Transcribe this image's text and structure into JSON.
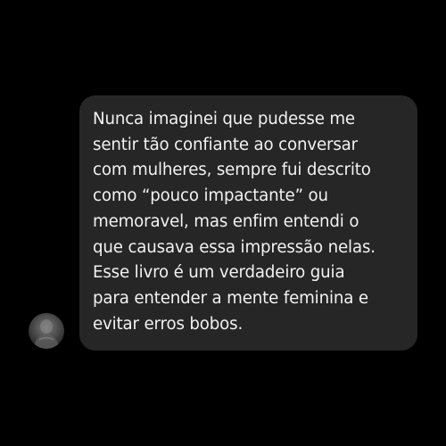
{
  "chat": {
    "sender_avatar_icon": "user-photo-avatar",
    "bubble_color": "#262626",
    "background_color": "#000000",
    "text_color": "#f2f2f2",
    "message_lines": [
      "Nunca imaginei que pudesse me",
      "sentir tão confiante ao conversar",
      "com mulheres, sempre fui descrito",
      "como “pouco impactante” ou",
      "memoravel, mas enfim entendi o",
      "que causava essa impressão nelas.",
      "Esse livro é um verdadeiro guia",
      "para entender a mente feminina e",
      "evitar erros bobos."
    ]
  }
}
